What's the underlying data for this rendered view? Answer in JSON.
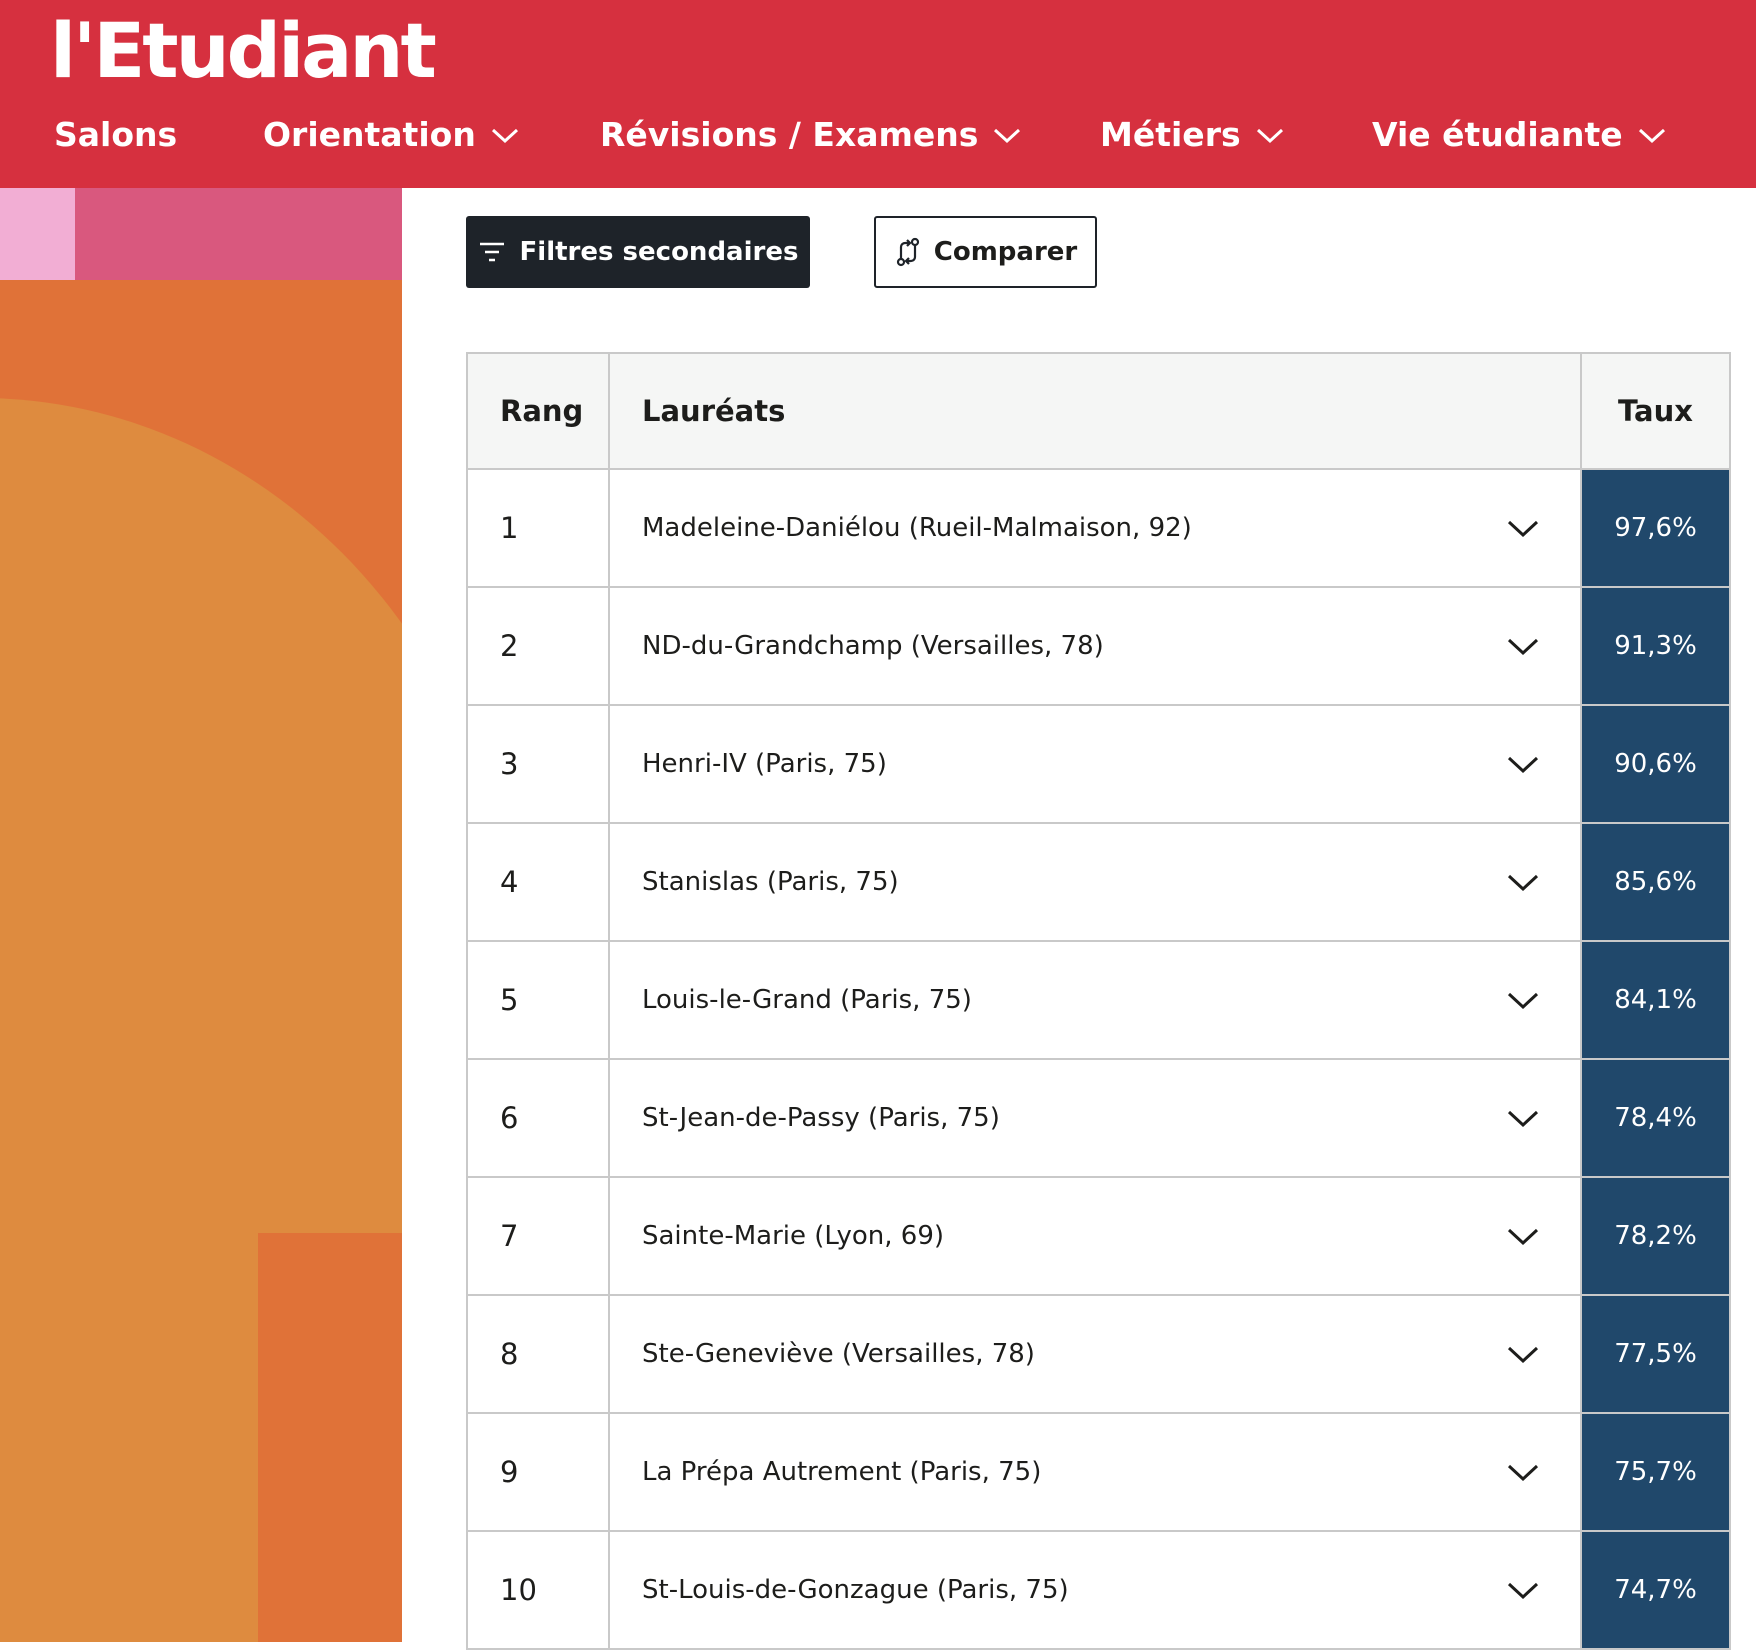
{
  "header": {
    "logo": "l'Etudiant",
    "nav": [
      {
        "label": "Salons",
        "has_dropdown": false
      },
      {
        "label": "Orientation",
        "has_dropdown": true
      },
      {
        "label": "Révisions / Examens",
        "has_dropdown": true
      },
      {
        "label": "Métiers",
        "has_dropdown": true
      },
      {
        "label": "Vie étudiante",
        "has_dropdown": true
      }
    ],
    "bg_color": "#d6303f"
  },
  "toolbar": {
    "filter_label": "Filtres secondaires",
    "compare_label": "Comparer"
  },
  "table": {
    "headers": {
      "rang": "Rang",
      "laureats": "Lauréats",
      "taux": "Taux"
    },
    "rows": [
      {
        "rang": "1",
        "name": "Madeleine-Daniélou (Rueil-Malmaison, 92)",
        "taux": "97,6%"
      },
      {
        "rang": "2",
        "name": "ND-du-Grandchamp (Versailles, 78)",
        "taux": "91,3%"
      },
      {
        "rang": "3",
        "name": "Henri-IV (Paris, 75)",
        "taux": "90,6%"
      },
      {
        "rang": "4",
        "name": "Stanislas (Paris, 75)",
        "taux": "85,6%"
      },
      {
        "rang": "5",
        "name": "Louis-le-Grand (Paris, 75)",
        "taux": "84,1%"
      },
      {
        "rang": "6",
        "name": "St-Jean-de-Passy (Paris, 75)",
        "taux": "78,4%"
      },
      {
        "rang": "7",
        "name": "Sainte-Marie (Lyon, 69)",
        "taux": "78,2%"
      },
      {
        "rang": "8",
        "name": "Ste-Geneviève (Versailles, 78)",
        "taux": "77,5%"
      },
      {
        "rang": "9",
        "name": "La Prépa Autrement (Paris, 75)",
        "taux": "75,7%"
      },
      {
        "rang": "10",
        "name": "St-Louis-de-Gonzague (Paris, 75)",
        "taux": "74,7%"
      }
    ],
    "taux_color": "#20486b"
  }
}
